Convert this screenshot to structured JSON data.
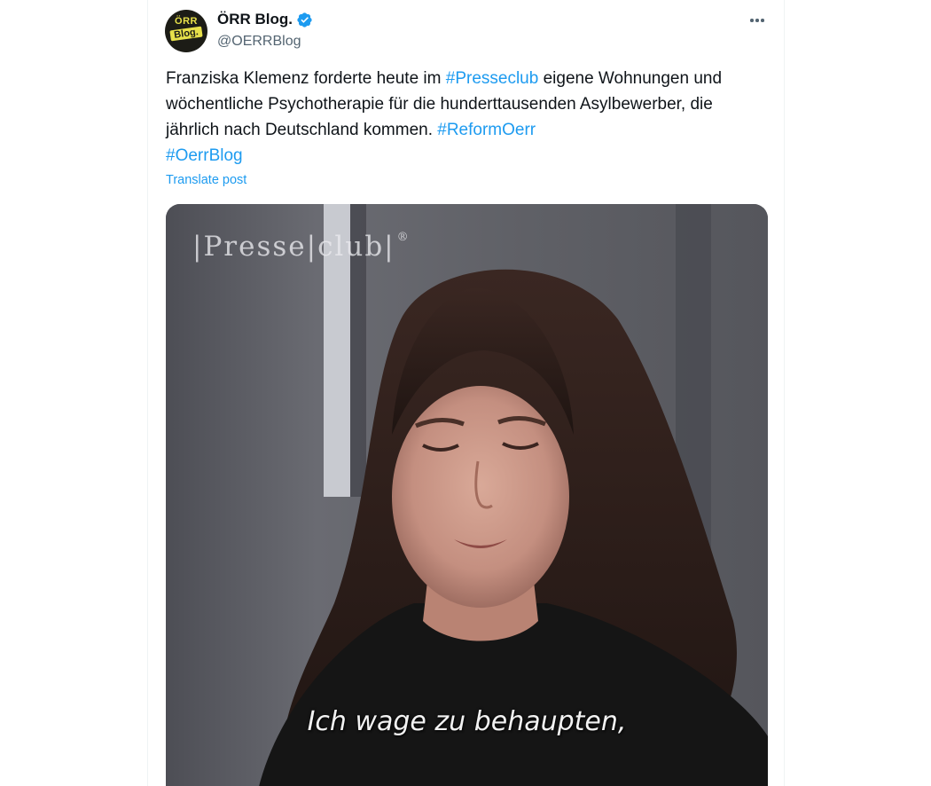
{
  "author": {
    "display_name": "ÖRR Blog.",
    "handle": "@OERRBlog",
    "avatar_text_top": "ÖRR",
    "avatar_text_bottom": "Blog."
  },
  "tweet": {
    "text_part1": "Franziska Klemenz forderte heute im ",
    "hashtag1": "#Presseclub",
    "text_part2": " eigene Wohnungen und wöchentliche Psychotherapie für die hunderttausenden Asylbewerber, die jährlich nach Deutschland kommen. ",
    "hashtag2": "#ReformOerr",
    "hashtag3": "#OerrBlog",
    "translate_label": "Translate post"
  },
  "media": {
    "show_logo": "|Presse|club|",
    "show_logo_mark": "®",
    "subtitle": "Ich wage zu behaupten,"
  },
  "colors": {
    "link": "#1d9bf0",
    "text": "#0f1419",
    "secondary": "#536471",
    "verified": "#1d9bf0"
  },
  "icons": {
    "verified": "verified-badge-icon",
    "more": "more-dots-icon"
  }
}
